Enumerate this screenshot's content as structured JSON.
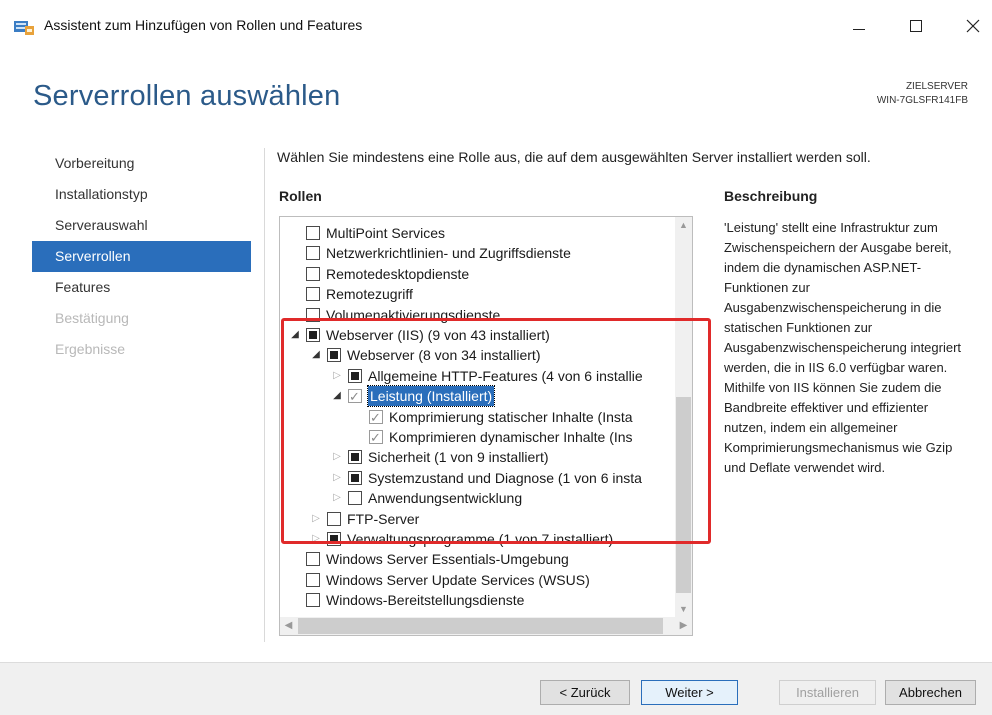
{
  "window": {
    "title": "Assistent zum Hinzufügen von Rollen und Features",
    "minimize_glyph": "—",
    "maximize_glyph": "☐",
    "close_glyph": "✕"
  },
  "page": {
    "title": "Serverrollen auswählen",
    "target_label": "ZIELSERVER",
    "target_name": "WIN-7GLSFR141FB"
  },
  "nav": {
    "items": [
      {
        "label": "Vorbereitung",
        "state": "normal"
      },
      {
        "label": "Installationstyp",
        "state": "normal"
      },
      {
        "label": "Serverauswahl",
        "state": "normal"
      },
      {
        "label": "Serverrollen",
        "state": "active"
      },
      {
        "label": "Features",
        "state": "normal"
      },
      {
        "label": "Bestätigung",
        "state": "disabled"
      },
      {
        "label": "Ergebnisse",
        "state": "disabled"
      }
    ]
  },
  "main": {
    "instruction": "Wählen Sie mindestens eine Rolle aus, die auf dem ausgewählten Server installiert werden soll.",
    "roles_header": "Rollen",
    "description_header": "Beschreibung",
    "description_text": "'Leistung' stellt eine Infrastruktur zum Zwischenspeichern der Ausgabe bereit, indem die dynamischen ASP.NET-Funktionen zur Ausgabenzwischenspeicherung in die statischen Funktionen zur Ausgabenzwischenspeicherung integriert werden, die in IIS 6.0 verfügbar waren. Mithilfe von IIS können Sie zudem die Bandbreite effektiver und effizienter nutzen, indem ein allgemeiner Komprimierungsmechanismus wie Gzip und Deflate verwendet wird."
  },
  "roles_tree": [
    {
      "label": "MultiPoint Services",
      "level": 0,
      "expander": "none",
      "check": "unchecked"
    },
    {
      "label": "Netzwerkrichtlinien- und Zugriffsdienste",
      "level": 0,
      "expander": "none",
      "check": "unchecked"
    },
    {
      "label": "Remotedesktopdienste",
      "level": 0,
      "expander": "none",
      "check": "unchecked"
    },
    {
      "label": "Remotezugriff",
      "level": 0,
      "expander": "none",
      "check": "unchecked"
    },
    {
      "label": "Volumenaktivierungsdienste",
      "level": 0,
      "expander": "none",
      "check": "unchecked"
    },
    {
      "label": "Webserver (IIS) (9 von 43 installiert)",
      "level": 0,
      "expander": "open",
      "check": "partial"
    },
    {
      "label": "Webserver (8 von 34 installiert)",
      "level": 1,
      "expander": "open",
      "check": "partial"
    },
    {
      "label": "Allgemeine HTTP-Features (4 von 6 installie",
      "level": 2,
      "expander": "closed",
      "check": "partial"
    },
    {
      "label": "Leistung (Installiert)",
      "level": 2,
      "expander": "open",
      "check": "checked",
      "selected": true
    },
    {
      "label": "Komprimierung statischer Inhalte (Insta",
      "level": 3,
      "expander": "none",
      "check": "checked"
    },
    {
      "label": "Komprimieren dynamischer Inhalte (Ins",
      "level": 3,
      "expander": "none",
      "check": "checked"
    },
    {
      "label": "Sicherheit (1 von 9 installiert)",
      "level": 2,
      "expander": "closed",
      "check": "partial"
    },
    {
      "label": "Systemzustand und Diagnose (1 von 6 insta",
      "level": 2,
      "expander": "closed",
      "check": "partial"
    },
    {
      "label": "Anwendungsentwicklung",
      "level": 2,
      "expander": "closed",
      "check": "unchecked"
    },
    {
      "label": "FTP-Server",
      "level": 1,
      "expander": "closed",
      "check": "unchecked"
    },
    {
      "label": "Verwaltungsprogramme (1 von 7 installiert)",
      "level": 1,
      "expander": "closed",
      "check": "partial"
    },
    {
      "label": "Windows Server Essentials-Umgebung",
      "level": 0,
      "expander": "none",
      "check": "unchecked"
    },
    {
      "label": "Windows Server Update Services (WSUS)",
      "level": 0,
      "expander": "none",
      "check": "unchecked"
    },
    {
      "label": "Windows-Bereitstellungsdienste",
      "level": 0,
      "expander": "none",
      "check": "unchecked"
    }
  ],
  "scroll": {
    "up": "▲",
    "down": "▼",
    "left": "◀",
    "right": "▶"
  },
  "footer": {
    "back": "< Zurück",
    "next": "Weiter >",
    "install": "Installieren",
    "cancel": "Abbrechen"
  },
  "colors": {
    "accent": "#2a6ebb",
    "title": "#2b5a89",
    "highlight": "#e02a2a"
  }
}
